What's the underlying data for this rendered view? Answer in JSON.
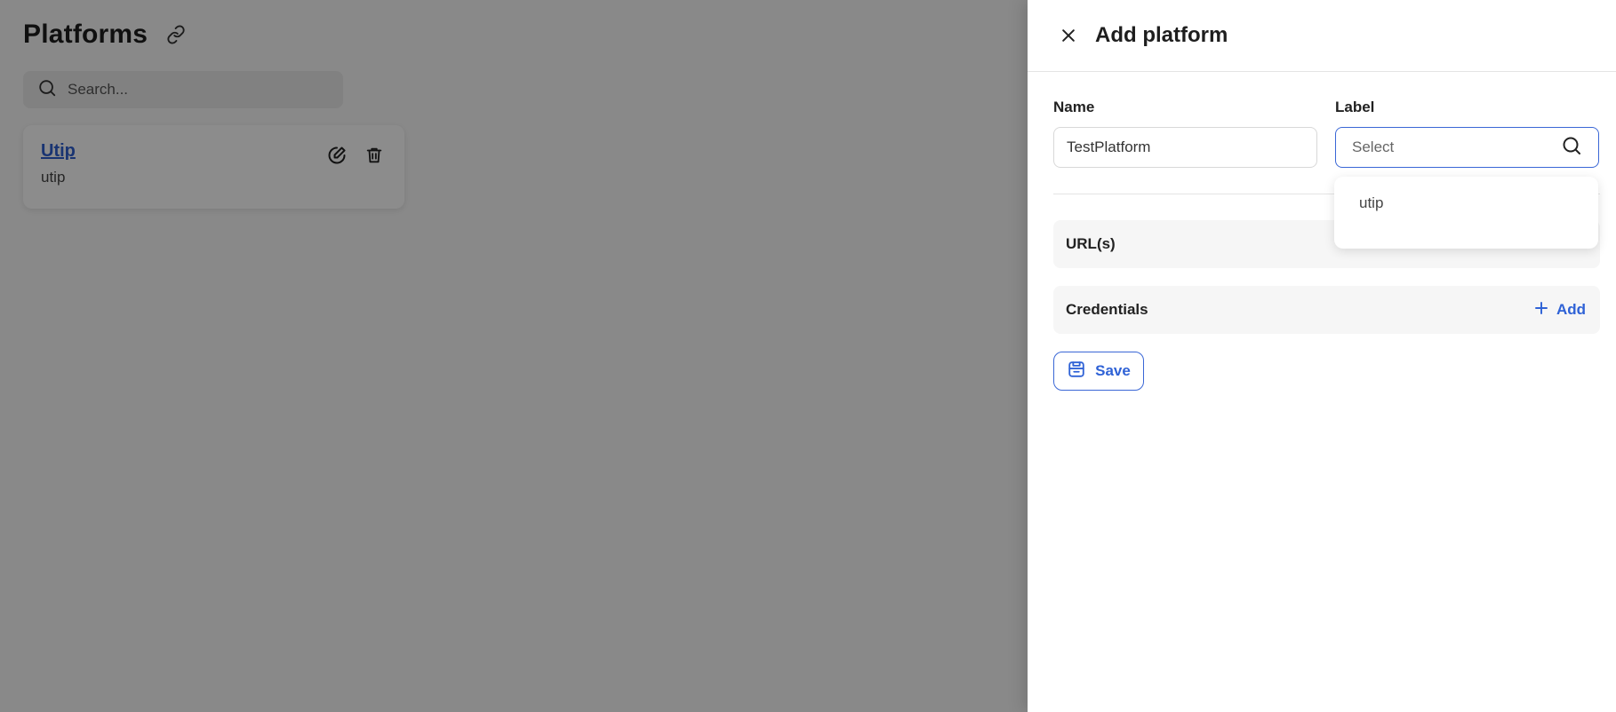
{
  "page": {
    "title": "Platforms",
    "search_placeholder": "Search...",
    "platforms": [
      {
        "name": "Utip",
        "label": "utip"
      }
    ]
  },
  "drawer": {
    "title": "Add platform",
    "name_label": "Name",
    "name_value": "TestPlatform",
    "label_label": "Label",
    "label_placeholder": "Select",
    "label_options": [
      "utip"
    ],
    "sections": [
      {
        "title": "URL(s)"
      },
      {
        "title": "Credentials",
        "action": "Add"
      }
    ],
    "save_label": "Save"
  },
  "colors": {
    "accent": "#2f62d6",
    "link": "#2f5fd0",
    "overlay": "rgba(0,0,0,0.45)"
  },
  "icons": {
    "title_link": "link-icon",
    "search": "search-icon",
    "edit": "edit-icon",
    "delete": "trash-icon",
    "close": "close-icon",
    "select_search": "search-icon",
    "add": "plus-icon",
    "save": "save-icon"
  }
}
